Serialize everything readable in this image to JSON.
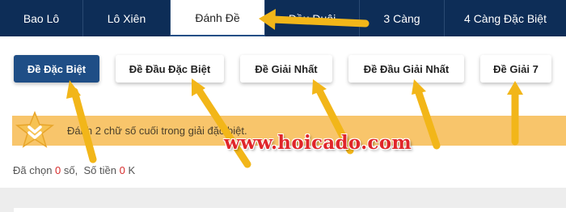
{
  "tabs": [
    {
      "label": "Bao Lô",
      "active": false
    },
    {
      "label": "Lô Xiên",
      "active": false
    },
    {
      "label": "Đánh Đề",
      "active": true
    },
    {
      "label": "Đầu Đuôi",
      "active": false
    },
    {
      "label": "3 Càng",
      "active": false
    },
    {
      "label": "4 Càng Đặc Biệt",
      "active": false
    }
  ],
  "sub_buttons": [
    {
      "label": "Đề Đặc Biệt",
      "active": true
    },
    {
      "label": "Đề Đầu Đặc Biệt",
      "active": false
    },
    {
      "label": "Đề Giải Nhất",
      "active": false
    },
    {
      "label": "Đề Đầu Giải Nhất",
      "active": false
    },
    {
      "label": "Đề Giải 7",
      "active": false
    }
  ],
  "info": {
    "text": "Đánh 2 chữ số cuối trong giải đặc biệt.",
    "icon": "star-chevron-icon"
  },
  "summary": {
    "selected_label": "Đã chọn",
    "selected_count": "0",
    "selected_unit": "số,",
    "amount_label": "Số tiền",
    "amount_value": "0",
    "amount_unit": "K"
  },
  "watermark": "www.hoicado.com",
  "colors": {
    "nav": "#0d2d57",
    "accent": "#1f4e86",
    "info_bg": "#f8c56b",
    "arrow": "#f2b619",
    "number": "#d62b2b",
    "watermark": "#e0262a"
  }
}
